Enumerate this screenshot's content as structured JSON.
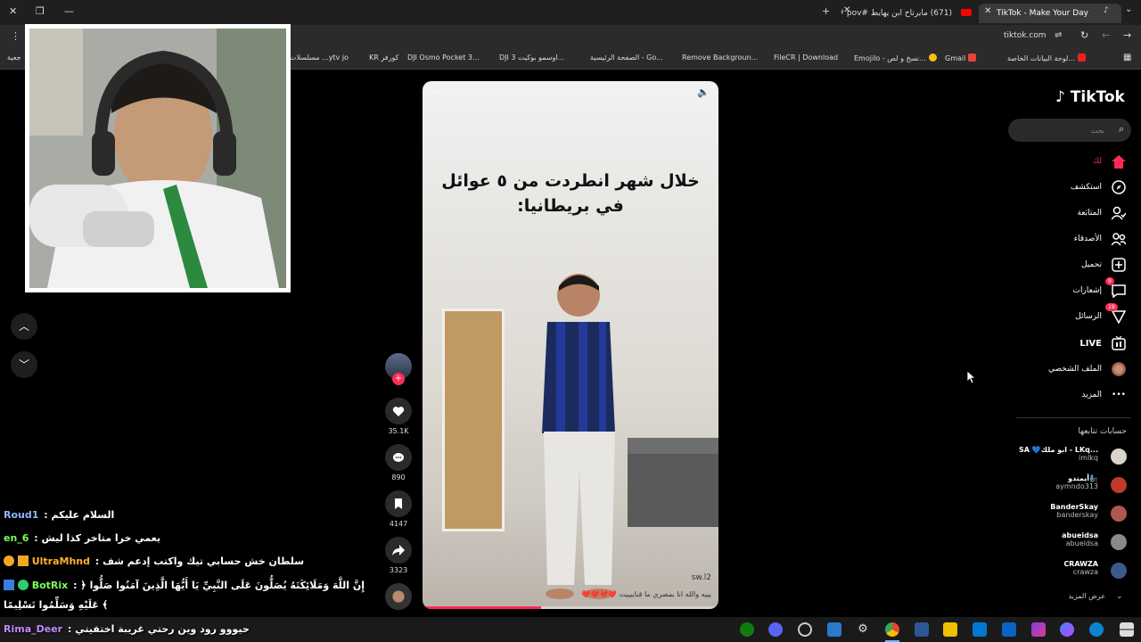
{
  "browser": {
    "tabs": [
      {
        "label": "TikTok - Make Your Day",
        "active": true
      },
      {
        "label": "(671) مايرتاح ابن يهايط #pov #تك",
        "active": false
      }
    ],
    "url": "tiktok.com",
    "bookmarks": [
      "لوحة البيانات الخاصة...",
      "Gmail",
      "Emojilo - نسخ و لص...",
      "FileCR | Download",
      "Remove Backgroun...",
      "الصفحة الرئيسية - Go...",
      "DJI اوسمو بوكيت 3...",
      "DJI Osmo Pocket 3...",
      "KR كورفر",
      "مسلسلات ...ytv jo",
      "جعية"
    ]
  },
  "tiktok": {
    "logo": "TikTok",
    "search_placeholder": "بحث",
    "nav": [
      {
        "label": "لك",
        "icon": "home-icon",
        "active": true
      },
      {
        "label": "استكشف",
        "icon": "compass-icon"
      },
      {
        "label": "المتابَعة",
        "icon": "user-follow-icon"
      },
      {
        "label": "الأصدقاء",
        "icon": "friends-icon"
      },
      {
        "label": "تحميل",
        "icon": "upload-icon"
      },
      {
        "label": "إشعارات",
        "icon": "inbox-icon",
        "badge": "9"
      },
      {
        "label": "الرسائل",
        "icon": "send-icon",
        "badge": "19"
      },
      {
        "label": "LIVE",
        "icon": "live-icon"
      },
      {
        "label": "الملف الشخصي",
        "icon": "avatar-icon"
      },
      {
        "label": "المزيد",
        "icon": "more-icon"
      }
    ],
    "following_title": "حسابات تتابعها",
    "following": [
      {
        "name": "SA 💙ابو ملك - LKq...",
        "handle": "imlkq"
      },
      {
        "name": "أيمندو🧞",
        "handle": "aymndo313"
      },
      {
        "name": "BanderSkay",
        "handle": "banderskay"
      },
      {
        "name": "abueidsa",
        "handle": "abueidsa"
      },
      {
        "name": "CRAWZA",
        "handle": "crawza"
      }
    ],
    "see_more": "عرض المزيد",
    "video": {
      "caption_line1": "خلال شهر انطردت من ٥ عوائل",
      "caption_line2": "في بريطانيا:",
      "watermark": "sw.l2",
      "subtitle": "يييه والله انا بمصري ما قناييييت ❤️❤️❤️❤️",
      "progress": 0.4
    },
    "actions": {
      "likes": "35.1K",
      "comments": "890",
      "saves": "4147",
      "shares": "3323"
    }
  },
  "chat": [
    {
      "user": "Roud1",
      "color": "#8fb4ff",
      "text": ": السلام عليكم"
    },
    {
      "user": "en_6",
      "color": "#7cff5a",
      "text": ": يعمي خرا متاخر كذا ليش"
    },
    {
      "user": "UltraMhnd",
      "color": "#ffb02e",
      "text": ": سلطان خش حسابي تيك واكتب إدعم شف"
    },
    {
      "user": "BotRix",
      "color": "#7cff5a",
      "text": ": ﴿ إِنَّ اللَّهَ وَمَلَائِكَتَهُ يُصَلُّونَ عَلَى النَّبِيِّ يَا أَيُّهَا الَّذِينَ آمَنُوا صَلُّوا"
    },
    {
      "user": "",
      "color": "#fff",
      "text": "عَلَيْهِ وَسَلِّمُوا تَسْلِيمًا ﴾"
    },
    {
      "user": "Rima_Deer",
      "color": "#c38bff",
      "text": ": حيووو رود وين رحتي غريبة اختفيتي"
    }
  ]
}
